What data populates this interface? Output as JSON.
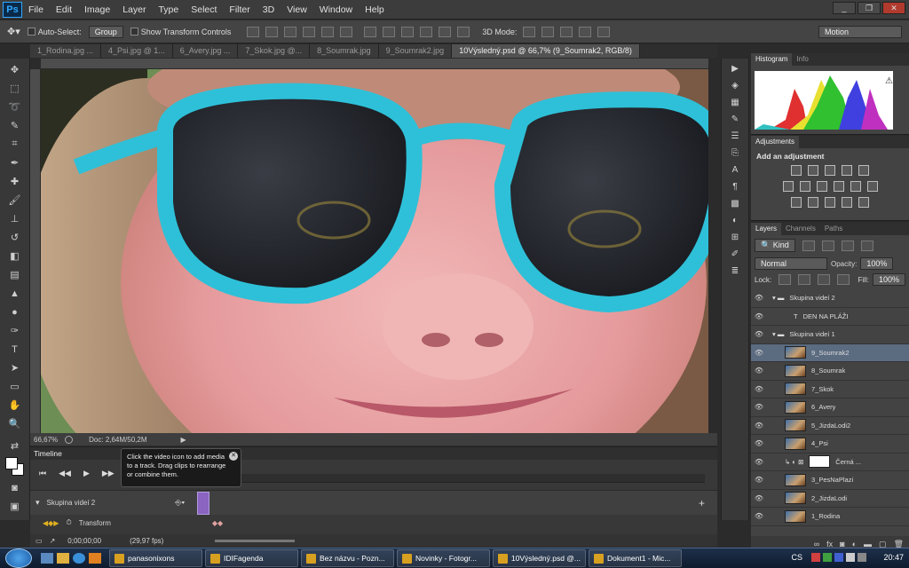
{
  "app": {
    "logo": "Ps",
    "menu": [
      "File",
      "Edit",
      "Image",
      "Layer",
      "Type",
      "Select",
      "Filter",
      "3D",
      "View",
      "Window",
      "Help"
    ],
    "window_controls": {
      "minimize": "_",
      "restore": "❐",
      "close": "✕"
    }
  },
  "options": {
    "auto_select_label": "Auto-Select:",
    "auto_select_value": "Group",
    "transform_label": "Show Transform Controls",
    "mode_3d_label": "3D Mode:",
    "workspace": "Motion"
  },
  "tabs": [
    {
      "label": "1_Rodina.jpg ...",
      "active": false
    },
    {
      "label": "4_Psi.jpg @ 1...",
      "active": false
    },
    {
      "label": "6_Avery.jpg ...",
      "active": false
    },
    {
      "label": "7_Skok.jpg @...",
      "active": false
    },
    {
      "label": "8_Soumrak.jpg",
      "active": false
    },
    {
      "label": "9_Soumrak2.jpg",
      "active": false
    },
    {
      "label": "10Výsledný.psd @ 66,7% (9_Soumrak2, RGB/8)",
      "active": true
    }
  ],
  "status": {
    "zoom": "66,67%",
    "doc": "Doc: 2,64M/50,2M"
  },
  "panels": {
    "histogram_tab": "Histogram",
    "info_tab": "Info",
    "adjustments_tab": "Adjustments",
    "add_adjustment": "Add an adjustment",
    "layers_tab": "Layers",
    "channels_tab": "Channels",
    "paths_tab": "Paths",
    "kind_filter": "Kind",
    "blend_mode": "Normal",
    "opacity_label": "Opacity:",
    "opacity_value": "100%",
    "lock_label": "Lock:",
    "fill_label": "Fill:",
    "fill_value": "100%"
  },
  "layers": [
    {
      "name": "Skupina videí 2",
      "type": "group"
    },
    {
      "name": "DEN NA PLÁŽI",
      "type": "text"
    },
    {
      "name": "Skupina videí 1",
      "type": "group"
    },
    {
      "name": "9_Soumrak2",
      "type": "layer",
      "selected": true
    },
    {
      "name": "8_Soumrak",
      "type": "layer"
    },
    {
      "name": "7_Skok",
      "type": "layer"
    },
    {
      "name": "6_Avery",
      "type": "layer"
    },
    {
      "name": "5_JizdaLodi2",
      "type": "layer"
    },
    {
      "name": "4_Psi",
      "type": "layer"
    },
    {
      "name": "Černá ...",
      "type": "adjustment"
    },
    {
      "name": "3_PesNaPlazi",
      "type": "layer"
    },
    {
      "name": "2_JizdaLodi",
      "type": "layer"
    },
    {
      "name": "1_Rodina",
      "type": "layer"
    }
  ],
  "timeline": {
    "title": "Timeline",
    "tooltip": "Click the video icon to add media to a track. Drag clips to rearrange or combine them.",
    "track_label": "Skupina videí 2",
    "transform_label": "Transform",
    "timecode": "0;00;00;00",
    "fps": "(29,97 fps)"
  },
  "taskbar": {
    "items": [
      "panasonixons",
      "IDIFagenda",
      "Bez názvu - Pozn...",
      "Novinky - Fotogr...",
      "10Výsledný.psd @...",
      "Dokument1 - Mic..."
    ],
    "lang": "CS",
    "clock": "20:47"
  }
}
